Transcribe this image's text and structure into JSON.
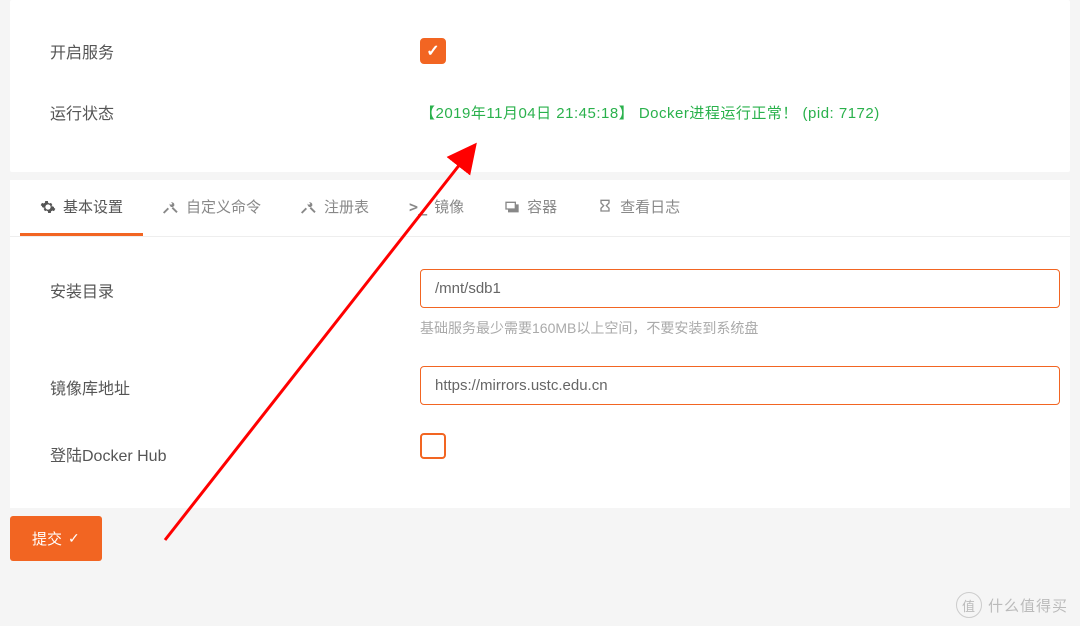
{
  "topSection": {
    "enableServiceLabel": "开启服务",
    "statusLabel": "运行状态",
    "statusText": "【2019年11月04日 21:45:18】 Docker进程运行正常！ (pid: 7172)"
  },
  "tabs": {
    "basic": "基本设置",
    "custom": "自定义命令",
    "registry": "注册表",
    "images": "镜像",
    "containers": "容器",
    "logs": "查看日志"
  },
  "settings": {
    "installDirLabel": "安装目录",
    "installDirValue": "/mnt/sdb1",
    "installDirHint": "基础服务最少需要160MB以上空间，不要安装到系统盘",
    "mirrorLabel": "镜像库地址",
    "mirrorValue": "https://mirrors.ustc.edu.cn",
    "loginLabel": "登陆Docker Hub"
  },
  "submit": "提交",
  "watermark": {
    "icon": "值",
    "text": "什么值得买"
  }
}
